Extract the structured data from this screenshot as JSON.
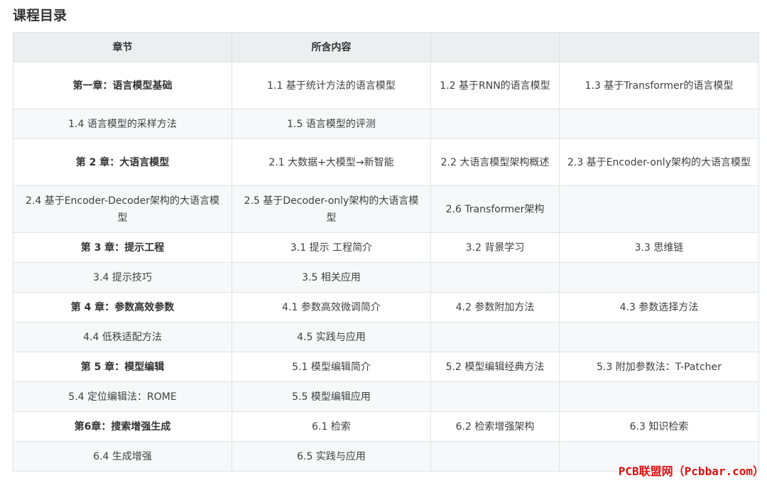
{
  "page_title": "课程目录",
  "table": {
    "headers": [
      "章节",
      "所含内容",
      "",
      ""
    ],
    "rows": [
      [
        "第一章：语言模型基础",
        "1.1 基于统计方法的语言模型",
        "1.2 基于RNN的语言模型",
        "1.3 基于Transformer的语言模型"
      ],
      [
        "1.4 语言模型的采样方法",
        "1.5 语言模型的评测",
        "",
        ""
      ],
      [
        "第 2 章：大语言模型",
        "2.1 大数据+大模型→新智能",
        "2.2 大语言模型架构概述",
        "2.3 基于Encoder-only架构的大语言模型"
      ],
      [
        "2.4 基于Encoder-Decoder架构的大语言模型",
        "2.5 基于Decoder-only架构的大语言模型",
        "2.6 Transformer架构",
        ""
      ],
      [
        "第 3 章：提示工程",
        "3.1 提示 工程简介",
        "3.2 背景学习",
        "3.3 思维链"
      ],
      [
        "3.4 提示技巧",
        "3.5 相关应用",
        "",
        ""
      ],
      [
        "第 4 章：参数高效参数",
        "4.1 参数高效微调简介",
        "4.2 参数附加方法",
        "4.3 参数选择方法"
      ],
      [
        "4.4 低秩适配方法",
        "4.5 实践与应用",
        "",
        ""
      ],
      [
        "第 5 章：模型编辑",
        "5.1 模型编辑简介",
        "5.2 模型编辑经典方法",
        "5.3 附加参数法：T-Patcher"
      ],
      [
        "5.4 定位编辑法：ROME",
        "5.5 模型编辑应用",
        "",
        ""
      ],
      [
        "第6章：搜索增强生成",
        "6.1 检索",
        "6.2 检索增强架构",
        "6.3 知识检索"
      ],
      [
        "6.4 生成增强",
        "6.5 实践与应用",
        "",
        ""
      ]
    ]
  },
  "watermark": "PCB联盟网（Pcbbar.com）"
}
